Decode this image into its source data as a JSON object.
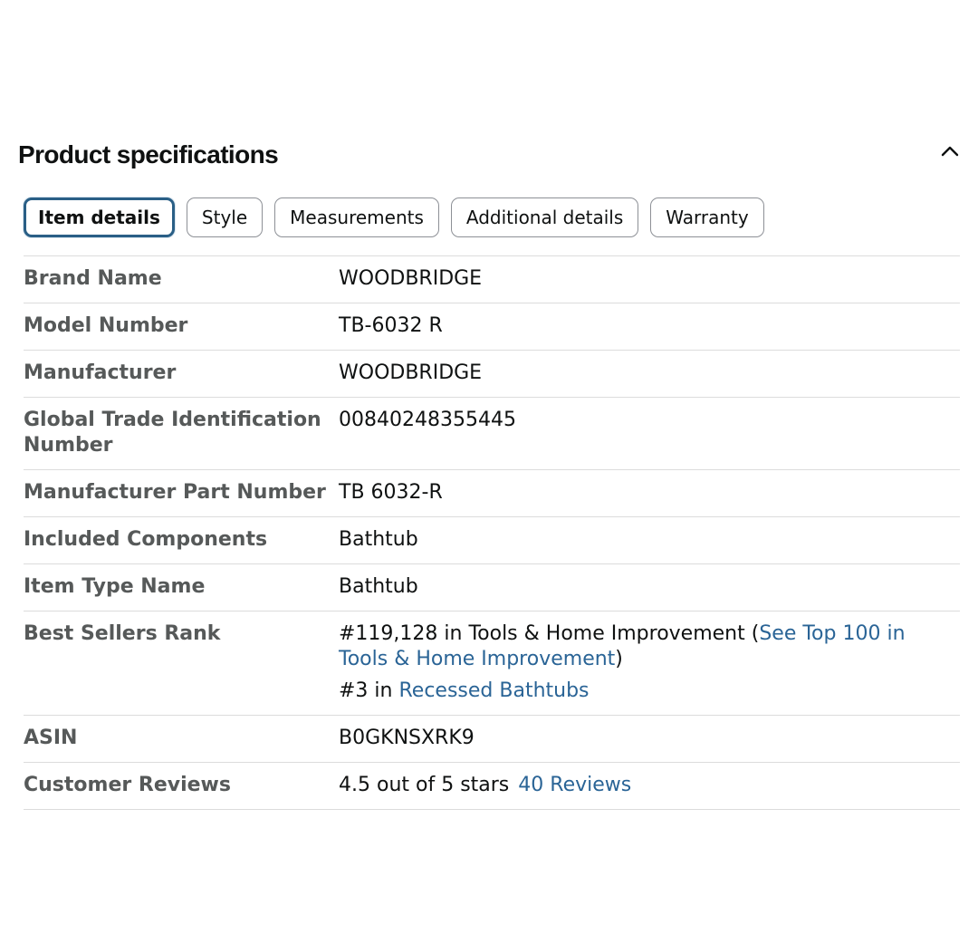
{
  "section": {
    "title": "Product specifications"
  },
  "tabs": [
    {
      "label": "Item details"
    },
    {
      "label": "Style"
    },
    {
      "label": "Measurements"
    },
    {
      "label": "Additional details"
    },
    {
      "label": "Warranty"
    }
  ],
  "active_tab": "Item details",
  "icons": {
    "collapse": "chevron-up-icon"
  },
  "colors": {
    "link": "#2a6496",
    "active_tab_border": "#2a5f86",
    "label": "#565959",
    "text": "#0f1111"
  },
  "specs": {
    "brand_name": {
      "label": "Brand Name",
      "value": "WOODBRIDGE"
    },
    "model_number": {
      "label": "Model Number",
      "value": "TB-6032 R"
    },
    "manufacturer": {
      "label": "Manufacturer",
      "value": "WOODBRIDGE"
    },
    "gtin": {
      "label": "Global Trade Identification Number",
      "value": "00840248355445"
    },
    "part_number": {
      "label": "Manufacturer Part Number",
      "value": "TB 6032-R"
    },
    "included_components": {
      "label": "Included Components",
      "value": "Bathtub"
    },
    "item_type_name": {
      "label": "Item Type Name",
      "value": "Bathtub"
    },
    "best_sellers_rank": {
      "label": "Best Sellers Rank",
      "rank_1": {
        "text": "#119,128 in Tools & Home Improvement (",
        "link": "See Top 100 in Tools & Home Improvement",
        "close": ")"
      },
      "rank_2": {
        "text": "#3 in ",
        "link": "Recessed Bathtubs"
      }
    },
    "asin": {
      "label": "ASIN",
      "value": "B0GKNSXRK9"
    },
    "customer_reviews": {
      "label": "Customer Reviews",
      "rating_text": "4.5 out of 5 stars",
      "review_count": "40",
      "reviews_link": "Reviews"
    }
  }
}
